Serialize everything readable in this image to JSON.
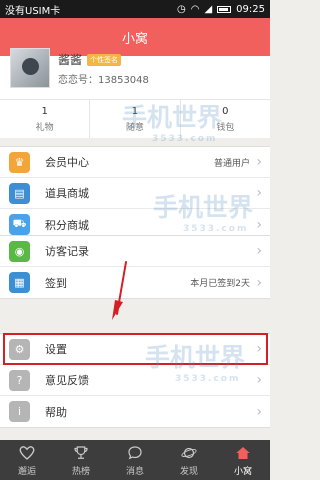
{
  "status_bar": {
    "carrier": "没有USIM卡",
    "time": "09:25"
  },
  "header": {
    "title": "小窝"
  },
  "profile": {
    "nickname": "酱酱",
    "badge": "个性签名",
    "love_number": "恋恋号：13853048"
  },
  "stats": [
    {
      "value": "1",
      "label": "礼物"
    },
    {
      "value": "1",
      "label": "随意"
    },
    {
      "value": "0",
      "label": "钱包"
    }
  ],
  "menu_group_1": [
    {
      "label": "会员中心",
      "value": "普通用户",
      "icon": "crown-icon",
      "color": "#f3a53a"
    },
    {
      "label": "道具商城",
      "value": "",
      "icon": "store-icon",
      "color": "#3d8ed4"
    },
    {
      "label": "积分商城",
      "value": "",
      "icon": "cart-icon",
      "color": "#4aa3e8"
    }
  ],
  "menu_group_2": [
    {
      "label": "访客记录",
      "value": "",
      "icon": "eye-icon",
      "color": "#58b946"
    },
    {
      "label": "签到",
      "value": "本月已签到2天",
      "icon": "calendar-icon",
      "color": "#3b8fd2"
    }
  ],
  "menu_group_3": [
    {
      "label": "设置",
      "value": "",
      "icon": "gear-icon",
      "color": "#b5b5b5"
    },
    {
      "label": "意见反馈",
      "value": "",
      "icon": "question-icon",
      "color": "#b5b5b5"
    },
    {
      "label": "帮助",
      "value": "",
      "icon": "info-icon",
      "color": "#b5b5b5"
    }
  ],
  "tabbar": [
    {
      "label": "邂逅",
      "active": false
    },
    {
      "label": "热榜",
      "active": false
    },
    {
      "label": "消息",
      "active": false
    },
    {
      "label": "发现",
      "active": false
    },
    {
      "label": "小窝",
      "active": true
    }
  ],
  "watermark": {
    "text": "手机世界",
    "sub": "3533.com"
  },
  "colors": {
    "accent": "#f2605e",
    "highlight": "#d51f24",
    "tabbar": "#3d3d3d"
  }
}
